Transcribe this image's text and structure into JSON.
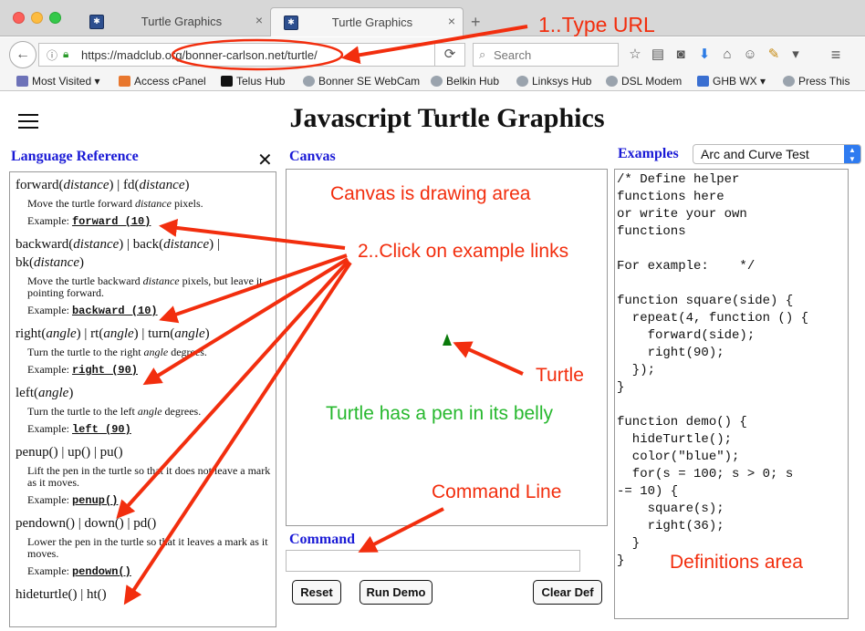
{
  "browser": {
    "tabs": [
      {
        "title": "Turtle Graphics",
        "favicon": "turtle-favicon-icon",
        "active": false
      },
      {
        "title": "Turtle Graphics",
        "favicon": "turtle-favicon-icon",
        "active": true
      }
    ],
    "close_tab_glyph": "×",
    "new_tab_glyph": "+",
    "url": "https://madclub.org/bonner-carlson.net/turtle/",
    "search_placeholder": "Search",
    "bookmarks": [
      {
        "label": "Most Visited",
        "icon": "folder-icon"
      },
      {
        "label": "Access cPanel",
        "icon": "cpanel-icon"
      },
      {
        "label": "Telus Hub",
        "icon": "n-logo-icon"
      },
      {
        "label": "Bonner SE WebCam",
        "icon": "globe-icon"
      },
      {
        "label": "Belkin Hub",
        "icon": "globe-icon"
      },
      {
        "label": "Linksys Hub",
        "icon": "globe-icon"
      },
      {
        "label": "DSL Modem",
        "icon": "globe-icon"
      },
      {
        "label": "GHB WX",
        "icon": "weather-icon"
      },
      {
        "label": "Press This",
        "icon": "globe-icon"
      }
    ]
  },
  "page": {
    "title": "Javascript Turtle Graphics",
    "reference_label": "Language Reference",
    "canvas_label": "Canvas",
    "command_label": "Command",
    "examples_label": "Examples",
    "examples_selected": "Arc and Curve Test",
    "buttons": {
      "reset": "Reset",
      "run_demo": "Run Demo",
      "clear_def": "Clear Def"
    },
    "reference": [
      {
        "sig_html": "forward(<i>distance</i>) | fd(<i>distance</i>)",
        "desc_html": "Move the turtle forward <i>distance</i> pixels.",
        "example_prefix": "Example: ",
        "example": "forward (10)"
      },
      {
        "sig_html": "backward(<i>distance</i>) | back(<i>distance</i>) | bk(<i>distance</i>)",
        "desc_html": "Move the turtle backward <i>distance</i> pixels, but leave it pointing forward.",
        "example_prefix": "Example: ",
        "example": "backward (10)"
      },
      {
        "sig_html": "right(<i>angle</i>) | rt(<i>angle</i>) | turn(<i>angle</i>)",
        "desc_html": "Turn the turtle to the right <i>angle</i> degrees.",
        "example_prefix": "Example: ",
        "example": "right (90)"
      },
      {
        "sig_html": "left(<i>angle</i>)",
        "desc_html": "Turn the turtle to the left <i>angle</i> degrees.",
        "example_prefix": "Example: ",
        "example": "left (90)"
      },
      {
        "sig_html": "penup() | up() | pu()",
        "desc_html": "Lift the pen in the turtle so that it does not leave a mark as it moves.",
        "example_prefix": "Example: ",
        "example": "penup()"
      },
      {
        "sig_html": "pendown() | down() | pd()",
        "desc_html": "Lower the pen in the turtle so that it leaves a mark as it moves.",
        "example_prefix": "Example: ",
        "example": "pendown()"
      },
      {
        "sig_html": "hideturtle() | ht()",
        "desc_html": "",
        "example_prefix": "",
        "example": ""
      }
    ],
    "definitions": "/* Define helper\nfunctions here\nor write your own\nfunctions\n\nFor example:    */\n\nfunction square(side) {\n  repeat(4, function () {\n    forward(side);\n    right(90);\n  });\n}\n\nfunction demo() {\n  hideTurtle();\n  color(\"blue\");\n  for(s = 100; s > 0; s\n-= 10) {\n    square(s);\n    right(36);\n  }\n}"
  },
  "annotations": {
    "type_url": "1..Type URL",
    "click_examples": "2..Click on example links",
    "canvas_note": "Canvas is drawing area",
    "turtle": "Turtle",
    "pen_note": "Turtle has a pen in its belly",
    "command_line": "Command Line",
    "definitions_area": "Definitions area"
  },
  "colors": {
    "annotation_red": "#f22e0e",
    "annotation_green": "#27b82e",
    "label_blue": "#1a1ad6",
    "turtle_green": "#0a7a0a",
    "select_accent": "#2f7bf0"
  }
}
